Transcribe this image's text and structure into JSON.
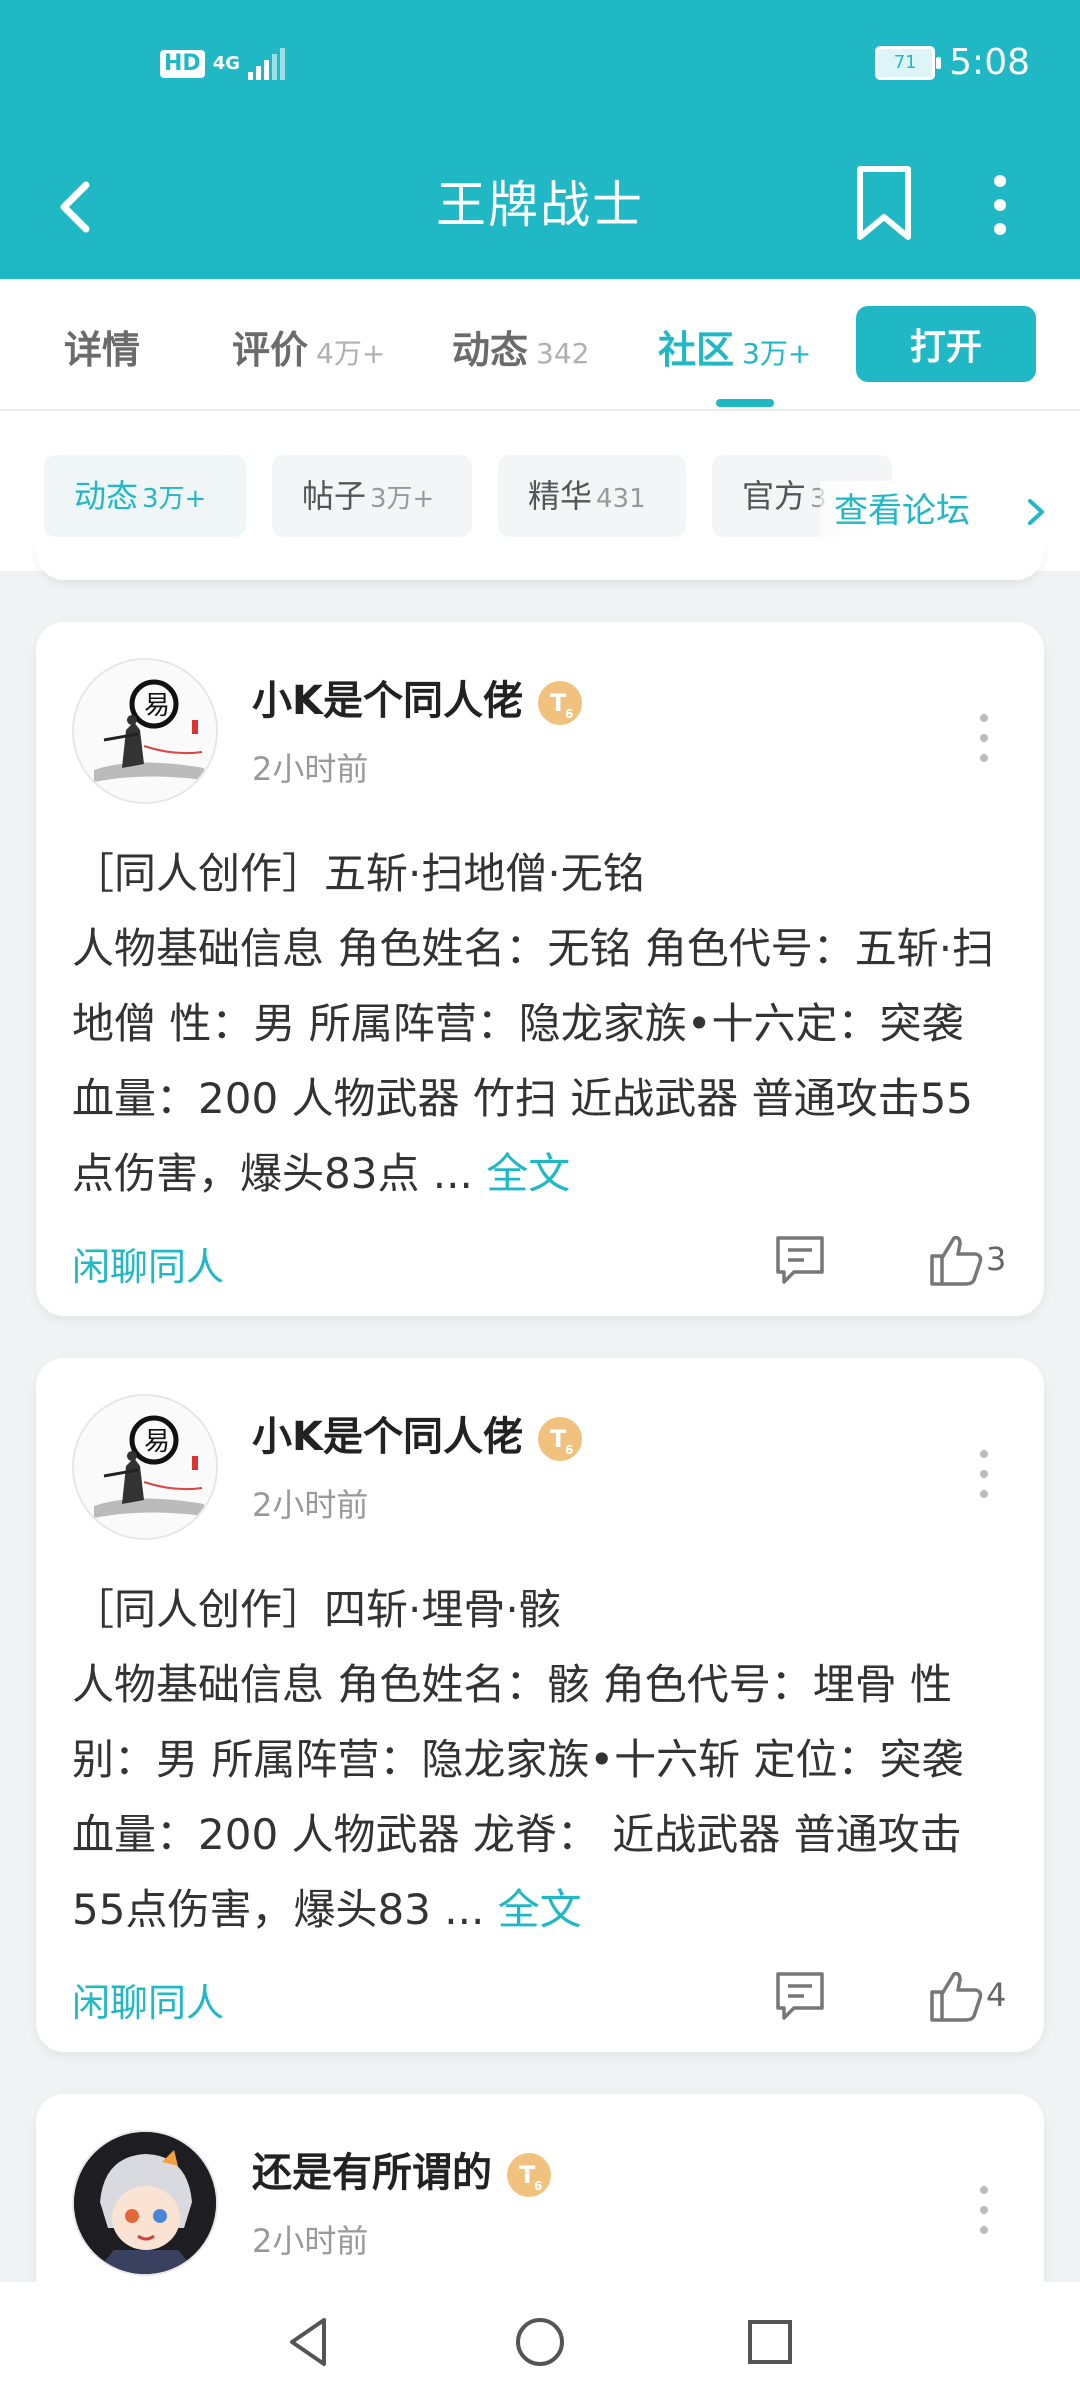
{
  "status_bar": {
    "network": "HD",
    "signal": "4G",
    "battery": "71",
    "time": "5:08"
  },
  "header": {
    "title": "王牌战士"
  },
  "tabs": [
    {
      "label": "详情",
      "count": ""
    },
    {
      "label": "评价",
      "count": "4万+"
    },
    {
      "label": "动态",
      "count": "342"
    },
    {
      "label": "社区",
      "count": "3万+"
    }
  ],
  "open_button": "打开",
  "chips": [
    {
      "label": "动态",
      "count": "3万+"
    },
    {
      "label": "帖子",
      "count": "3万+"
    },
    {
      "label": "精华",
      "count": "431"
    },
    {
      "label": "官方",
      "count": "3"
    }
  ],
  "forum_link": "查看论坛",
  "posts": [
    {
      "author": "小K是个同人佬",
      "time": "2小时前",
      "body": "［同人创作］五斩·扫地僧·无铭\n人物基础信息 角色姓名：无铭 角色代号：五斩·扫地僧 性：男 所属阵营：隐龙家族•十六定：突袭 血量：200 人物武器 竹扫 近战武器 普通攻击55点伤害，爆头83点 ...",
      "more": "全文",
      "tag": "闲聊同人",
      "likes": "3"
    },
    {
      "author": "小K是个同人佬",
      "time": "2小时前",
      "body": "［同人创作］四斩·埋骨·骸\n人物基础信息 角色姓名：骸 角色代号：埋骨 性别：男 所属阵营：隐龙家族•十六斩 定位：突袭 血量：200 人物武器 龙脊： 近战武器 普通攻击55点伤害，爆头83 ...",
      "more": "全文",
      "tag": "闲聊同人",
      "likes": "4"
    },
    {
      "author": "还是有所谓的",
      "time": "2小时前"
    }
  ],
  "colors": {
    "accent": "#21b8c6"
  }
}
